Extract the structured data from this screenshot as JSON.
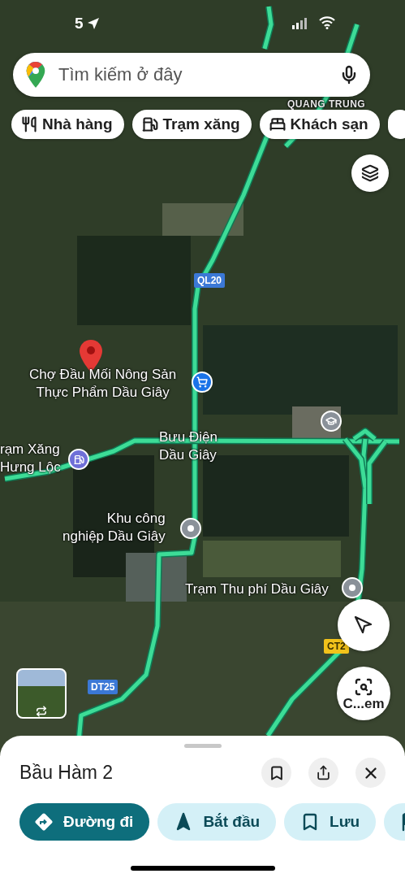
{
  "status_bar": {
    "time": "5"
  },
  "search": {
    "placeholder": "Tìm kiếm ở đây"
  },
  "chips": [
    {
      "kind": "restaurant",
      "label": "Nhà hàng"
    },
    {
      "kind": "gas",
      "label": "Trạm xăng"
    },
    {
      "kind": "hotel",
      "label": "Khách sạn"
    }
  ],
  "map": {
    "labels": [
      {
        "kind": "area",
        "lines": [
          "QUANG TRUNG"
        ]
      },
      {
        "kind": "selected",
        "lines": [
          "Chợ Đầu Mối Nông Sản",
          "Thực Phẩm Dầu Giây"
        ]
      },
      {
        "kind": "shop"
      },
      {
        "kind": "place",
        "lines": [
          "Bưu Điện",
          "Dầu Giây"
        ]
      },
      {
        "kind": "school"
      },
      {
        "kind": "gas",
        "lines": [
          "rạm Xăng",
          "Hưng Lộc"
        ]
      },
      {
        "kind": "place",
        "lines": [
          "Khu công",
          "nghiệp Dầu Giây"
        ]
      },
      {
        "kind": "place",
        "lines": [
          "Trạm Thu phí Dầu Giây"
        ]
      }
    ],
    "shields": [
      {
        "kind": "national",
        "label": "QL20"
      },
      {
        "kind": "national",
        "label": "DT25"
      },
      {
        "kind": "expressway",
        "label": "CT2"
      }
    ]
  },
  "camera_button": {
    "label": "C...em"
  },
  "sheet": {
    "title": "Bầu Hàm 2",
    "actions": [
      {
        "kind": "directions",
        "label": "Đường đi",
        "selected": true
      },
      {
        "kind": "start",
        "label": "Bắt đầu",
        "selected": false
      },
      {
        "kind": "save",
        "label": "Lưu",
        "selected": false
      },
      {
        "kind": "flag",
        "selected": false
      }
    ]
  }
}
